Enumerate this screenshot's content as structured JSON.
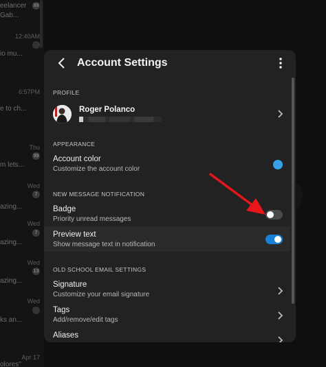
{
  "background": {
    "items": [
      {
        "snippet": "eelancer",
        "time": "",
        "badge": "99"
      },
      {
        "snippet": "Gab...",
        "time": "",
        "badge": ""
      },
      {
        "snippet": "",
        "time": "12:40AM",
        "badge": ""
      },
      {
        "snippet": "io mu...",
        "time": "",
        "badge": ""
      },
      {
        "snippet": "",
        "time": "6:57PM",
        "badge": ""
      },
      {
        "snippet": "e to ch...",
        "time": "",
        "badge": ""
      },
      {
        "snippet": "",
        "time": "Thu",
        "badge": "99"
      },
      {
        "snippet": "m lets...",
        "time": "",
        "badge": ""
      },
      {
        "snippet": "",
        "time": "Wed",
        "badge": "7"
      },
      {
        "snippet": "azing...",
        "time": "",
        "badge": ""
      },
      {
        "snippet": "",
        "time": "Wed",
        "badge": "7"
      },
      {
        "snippet": "azing...",
        "time": "",
        "badge": ""
      },
      {
        "snippet": "",
        "time": "Wed",
        "badge": "13"
      },
      {
        "snippet": "azing...",
        "time": "",
        "badge": ""
      },
      {
        "snippet": "",
        "time": "Wed",
        "badge": ""
      },
      {
        "snippet": "ks an...",
        "time": "",
        "badge": ""
      },
      {
        "snippet": "",
        "time": "Apr 17",
        "badge": ""
      },
      {
        "snippet": "olores\"",
        "time": "",
        "badge": ""
      }
    ]
  },
  "modal": {
    "title": "Account Settings",
    "profile": {
      "section_label": "PROFILE",
      "name": "Roger Polanco"
    },
    "appearance": {
      "section_label": "APPEARANCE",
      "account_color_title": "Account color",
      "account_color_sub": "Customize the account color",
      "account_color_value": "#3aa0e8"
    },
    "notifications": {
      "section_label": "NEW MESSAGE NOTIFICATION",
      "badge_title": "Badge",
      "badge_sub": "Priority unread messages",
      "badge_enabled": false,
      "preview_title": "Preview text",
      "preview_sub": "Show message text in notification",
      "preview_enabled": true
    },
    "old_school": {
      "section_label": "OLD SCHOOL EMAIL SETTINGS",
      "signature_title": "Signature",
      "signature_sub": "Customize your email signature",
      "tags_title": "Tags",
      "tags_sub": "Add/remove/edit tags",
      "aliases_title": "Aliases"
    }
  },
  "colors": {
    "accent_blue": "#1a7fd6",
    "arrow_red": "#e8151b"
  }
}
